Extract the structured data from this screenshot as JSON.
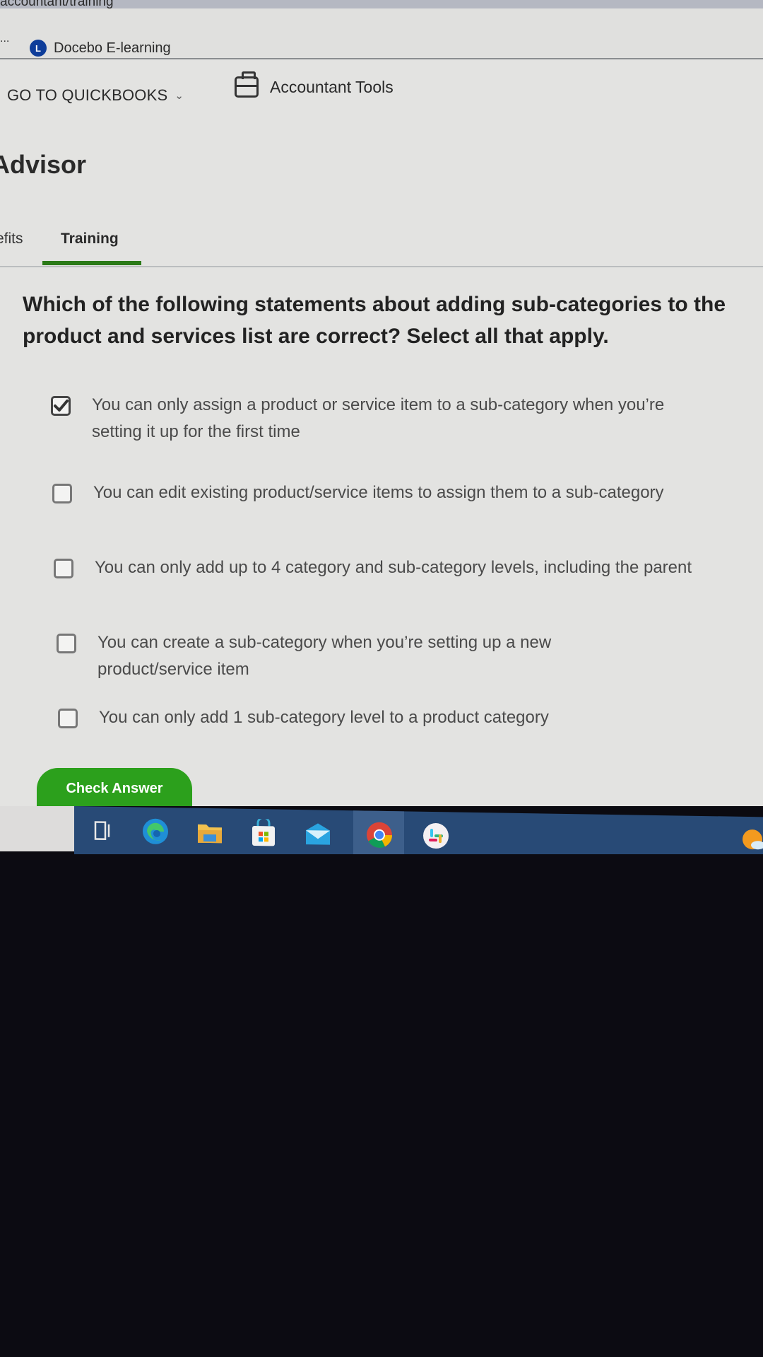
{
  "browser": {
    "url_fragment": "accountant/training",
    "bookmarks": {
      "overflow_label": "...",
      "items": [
        {
          "label": "Docebo E-learning",
          "favicon_letter": "L",
          "favicon_color": "#0e3d9a"
        }
      ]
    }
  },
  "topnav": {
    "goto_label": "GO TO QUICKBOOKS",
    "goto_icon": "chevron-down-icon",
    "accountant_tools_label": "Accountant Tools",
    "accountant_tools_icon": "briefcase-icon"
  },
  "page": {
    "title": "Advisor",
    "tabs": [
      {
        "label": "Benefits",
        "visible_text": "efits",
        "active": false
      },
      {
        "label": "Training",
        "active": true
      }
    ],
    "accent_color": "#2b7a18"
  },
  "quiz": {
    "question": "Which of the following statements about adding sub-categories to the product and services list are correct? Select all that apply.",
    "options": [
      {
        "text": "You can only assign a product or service item to a sub-category when you’re setting it up for the first time",
        "checked": true
      },
      {
        "text": "You can edit existing product/service items to assign them to a sub-category",
        "checked": false
      },
      {
        "text": "You can only add up to 4 category and sub-category levels, including the parent",
        "checked": false
      },
      {
        "text": "You can create a sub-category when you’re setting up a new product/service item",
        "checked": false
      },
      {
        "text": "You can only add 1 sub-category level to a product category",
        "checked": false
      }
    ],
    "submit_label": "Check Answer",
    "submit_color": "#2ca01c"
  },
  "taskbar": {
    "color": "#284a76",
    "apps": [
      {
        "name": "task-view",
        "icon": "task-view-icon"
      },
      {
        "name": "Microsoft Edge",
        "icon": "edge-icon"
      },
      {
        "name": "File Explorer",
        "icon": "folder-icon"
      },
      {
        "name": "Microsoft Store",
        "icon": "store-icon"
      },
      {
        "name": "Mail",
        "icon": "mail-icon"
      },
      {
        "name": "Google Chrome",
        "icon": "chrome-icon",
        "active": true,
        "running": true
      },
      {
        "name": "Slack",
        "icon": "slack-icon",
        "running": true
      },
      {
        "name": "Weather",
        "icon": "weather-icon"
      }
    ]
  }
}
